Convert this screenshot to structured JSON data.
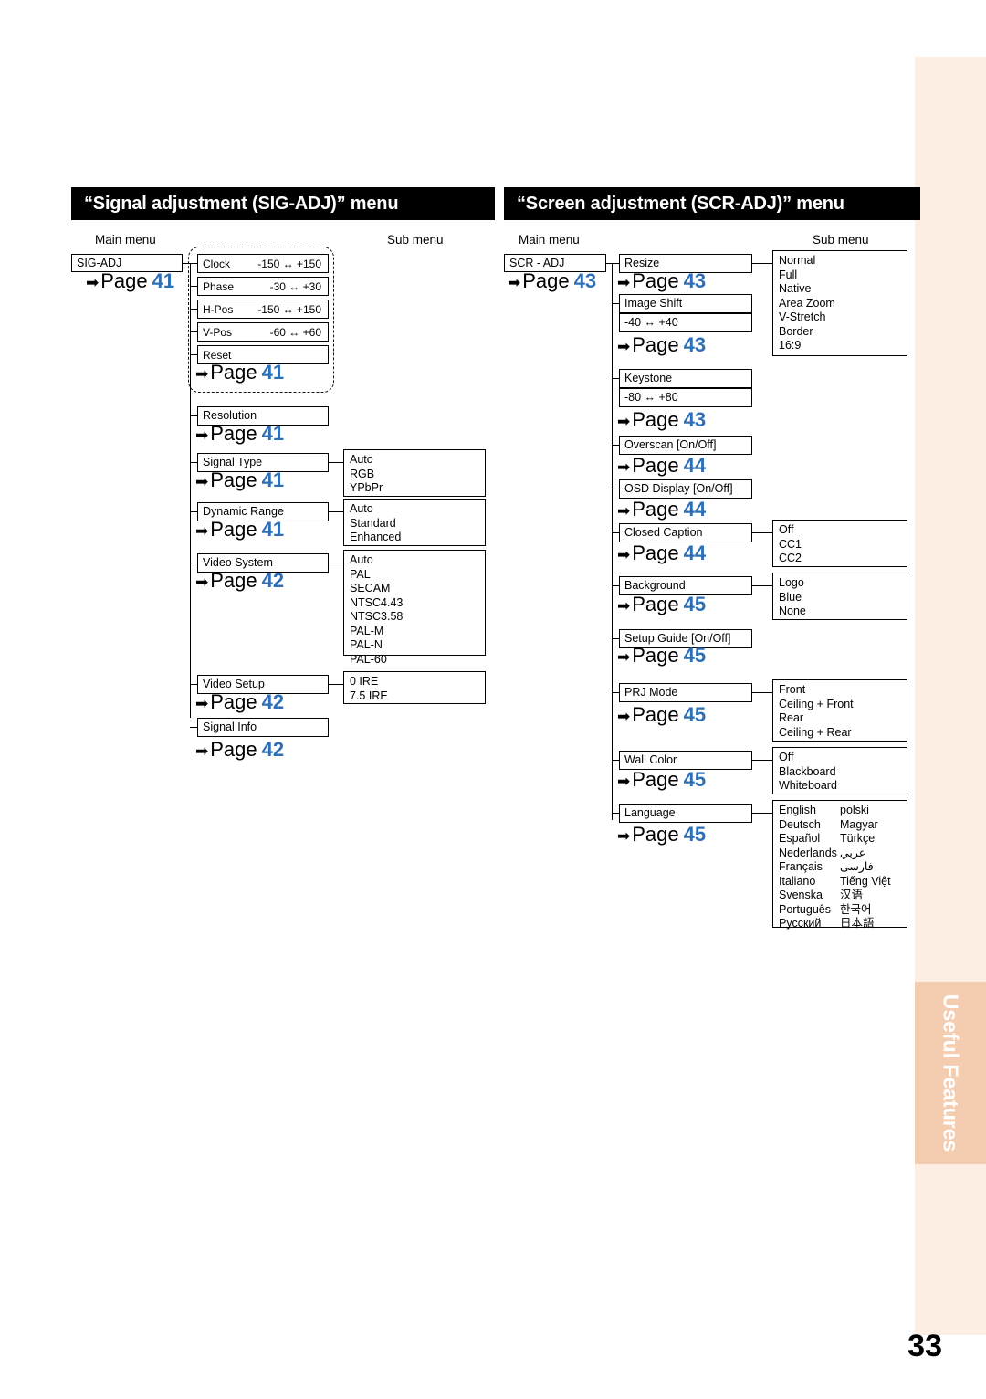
{
  "page_number": "33",
  "side_tab": "Useful Features",
  "left": {
    "header": "“Signal adjustment (SIG-ADJ)” menu",
    "col_main": "Main menu",
    "col_sub": "Sub menu",
    "main_item": "SIG-ADJ",
    "main_page": {
      "text": "Page",
      "num": "41"
    },
    "items": [
      {
        "name": "Clock",
        "range": "-150 ↔ +150"
      },
      {
        "name": "Phase",
        "range": "-30 ↔  +30"
      },
      {
        "name": "H-Pos",
        "range": "-150 ↔ +150"
      },
      {
        "name": "V-Pos",
        "range": "-60 ↔  +60"
      },
      {
        "name": "Reset",
        "range": ""
      }
    ],
    "group_page": {
      "text": "Page",
      "num": "41"
    },
    "resolution": "Resolution",
    "resolution_page": {
      "text": "Page",
      "num": "41"
    },
    "signal_type": "Signal Type",
    "signal_type_options": "Auto\nRGB\nYPbPr",
    "signal_type_page": {
      "text": "Page",
      "num": "41"
    },
    "dynamic_range": "Dynamic Range",
    "dynamic_range_options": "Auto\nStandard\nEnhanced",
    "dynamic_range_page": {
      "text": "Page",
      "num": "41"
    },
    "video_system": "Video System",
    "video_system_options": "Auto\nPAL\nSECAM\nNTSC4.43\nNTSC3.58\nPAL-M\nPAL-N\nPAL-60",
    "video_system_page": {
      "text": "Page",
      "num": "42"
    },
    "video_setup": "Video Setup",
    "video_setup_options": "0 IRE\n7.5 IRE",
    "video_setup_page": {
      "text": "Page",
      "num": "42"
    },
    "signal_info": "Signal Info",
    "signal_info_page": {
      "text": "Page",
      "num": "42"
    }
  },
  "right": {
    "header": "“Screen adjustment (SCR-ADJ)” menu",
    "col_main": "Main menu",
    "col_sub": "Sub menu",
    "main_item": "SCR - ADJ",
    "main_page": {
      "text": "Page",
      "num": "43"
    },
    "resize": "Resize",
    "resize_options": "Normal\nFull\nNative\nArea Zoom\nV-Stretch\nBorder\n16:9",
    "resize_page": {
      "text": "Page",
      "num": "43"
    },
    "image_shift": "Image Shift",
    "image_shift_range": "-40 ↔ +40",
    "image_shift_page": {
      "text": "Page",
      "num": "43"
    },
    "keystone": "Keystone",
    "keystone_range": "-80 ↔ +80",
    "keystone_page": {
      "text": "Page",
      "num": "43"
    },
    "overscan": "Overscan [On/Off]",
    "overscan_page": {
      "text": "Page",
      "num": "44"
    },
    "osd_display": "OSD Display [On/Off]",
    "osd_display_page": {
      "text": "Page",
      "num": "44"
    },
    "closed_caption": "Closed Caption",
    "closed_caption_options": "Off\nCC1\nCC2",
    "closed_caption_page": {
      "text": "Page",
      "num": "44"
    },
    "background": "Background",
    "background_options": "Logo\nBlue\nNone",
    "background_page": {
      "text": "Page",
      "num": "45"
    },
    "setup_guide": "Setup Guide [On/Off]",
    "setup_guide_page": {
      "text": "Page",
      "num": "45"
    },
    "prj_mode": "PRJ Mode",
    "prj_mode_options": "Front\nCeiling + Front\nRear\nCeiling + Rear",
    "prj_mode_page": {
      "text": "Page",
      "num": "45"
    },
    "wall_color": "Wall Color",
    "wall_color_options": "Off\nBlackboard\nWhiteboard",
    "wall_color_page": {
      "text": "Page",
      "num": "45"
    },
    "language": "Language",
    "language_col1": "English\nDeutsch\nEspañol\nNederlands\nFrançais\nItaliano\nSvenska\nPortuguês\nPусский",
    "language_col2": "polski\nMagyar\nTürkçe\nعربي\nفارسی\nTiếng Việt\n汉语\n한국어\n日本語",
    "language_page": {
      "text": "Page",
      "num": "45"
    }
  }
}
